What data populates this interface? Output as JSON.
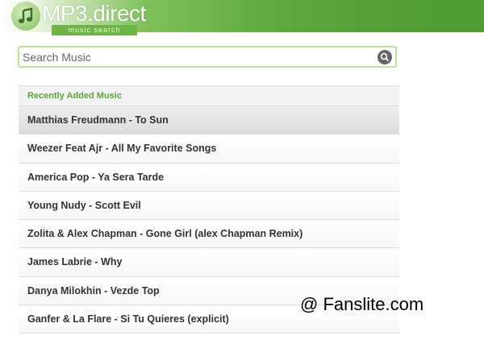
{
  "header": {
    "logo_text": "MP3.direct",
    "logo_sub": "music search",
    "accent_color": "#5da53d"
  },
  "search": {
    "placeholder": "Search Music",
    "value": ""
  },
  "recent": {
    "title": "Recently Added Music",
    "items": [
      "Matthias Freudmann - To Sun",
      "Weezer Feat Ajr - All My Favorite Songs",
      "America Pop - Ya Sera Tarde",
      "Young Nudy - Scott Evil",
      "Zolita & Alex Chapman - Gone Girl (alex Chapman Remix)",
      "James Labrie - Why",
      "Danya Milokhin - Vezde Top",
      "Ganfer & La Flare - Si Tu Quieres (explicit)"
    ]
  },
  "watermark": "@ Fanslite.com"
}
